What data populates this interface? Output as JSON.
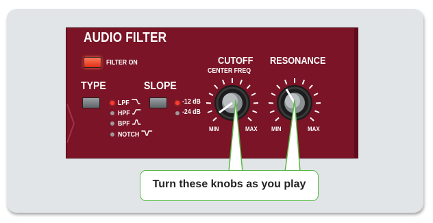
{
  "panel": {
    "title": "AUDIO FILTER",
    "filter_on_label": "FILTER ON",
    "type_label": "TYPE",
    "slope_label": "SLOPE",
    "type_options": [
      {
        "label": "LPF",
        "wave": "˥┐",
        "active": true
      },
      {
        "label": "HPF",
        "wave": "┐˥",
        "active": false
      },
      {
        "label": "BPF",
        "wave": "┴",
        "active": false
      },
      {
        "label": "NOTCH",
        "wave": "└┘",
        "active": false
      }
    ],
    "slope_options": [
      {
        "label": "-12 dB",
        "active": true
      },
      {
        "label": "-24 dB",
        "active": false
      }
    ],
    "cutoff": {
      "label": "CUTOFF",
      "sublabel": "CENTER FREQ",
      "min": "MIN",
      "max": "MAX"
    },
    "resonance": {
      "label": "RESONANCE",
      "min": "MIN",
      "max": "MAX"
    }
  },
  "callout": {
    "text": "Turn these knobs as you play"
  },
  "colors": {
    "panel": "#7a1426",
    "callout_border": "#58b947",
    "led_on": "#ff3c2a"
  }
}
